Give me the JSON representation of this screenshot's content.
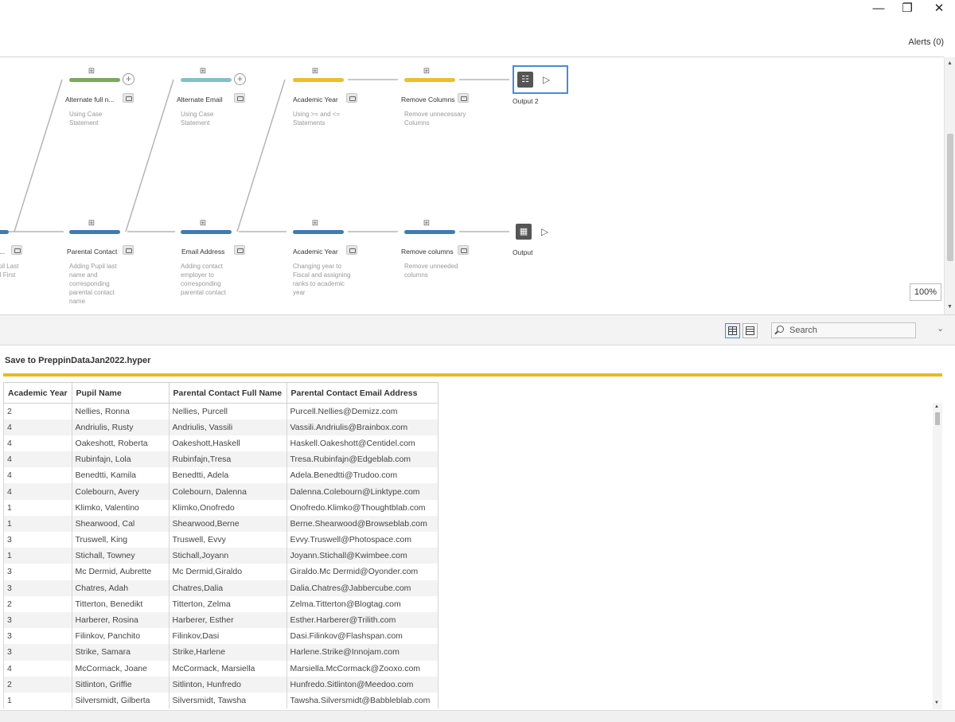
{
  "window": {
    "minimize_icon": "minimize-icon",
    "restore_icon": "restore-icon",
    "close_icon": "close-icon"
  },
  "alerts_label": "Alerts (0)",
  "flow": {
    "top_row": [
      {
        "name": "Alternate full n...",
        "desc": [
          "Using Case",
          "Statement"
        ],
        "color": "#7aa95c"
      },
      {
        "name": "Alternate Email",
        "desc": [
          "Using Case",
          "Statement"
        ],
        "color": "#83c1c9"
      },
      {
        "name": "Academic Year",
        "desc": [
          "Using >= and <=",
          "Statements"
        ],
        "color": "#ecbe2b"
      },
      {
        "name": "Remove Columns",
        "desc": [
          "Remove unnecessary",
          "Columns"
        ],
        "color": "#ecbe2b"
      }
    ],
    "top_output": {
      "name": "Output 2"
    },
    "bottom_row": [
      {
        "name": "...",
        "desc": [
          "pil Last",
          "il First"
        ],
        "color": "#3f7cae"
      },
      {
        "name": "Parental Contact",
        "desc": [
          "Adding Pupil last",
          "name and",
          "corresponding",
          "parental contact",
          "name"
        ],
        "color": "#3f7cae"
      },
      {
        "name": "Email Address",
        "desc": [
          "Adding contact",
          "employer to",
          "corresponding",
          "parental contact"
        ],
        "color": "#3f7cae"
      },
      {
        "name": "Academic Year",
        "desc": [
          "Changing year to",
          "Fiscal and assigning",
          "ranks to academic",
          "year"
        ],
        "color": "#3f7cae"
      },
      {
        "name": "Remove columns",
        "desc": [
          "Remove unneeded",
          "columns"
        ],
        "color": "#3f7cae"
      }
    ],
    "bottom_output": {
      "name": "Output"
    },
    "zoom": "100%"
  },
  "search": {
    "placeholder": "Search"
  },
  "save_label": "Save to PreppinDataJan2022.hyper",
  "table": {
    "columns": [
      "Academic Year",
      "Pupil Name",
      "Parental Contact Full Name",
      "Parental Contact Email Address"
    ],
    "rows": [
      [
        "2",
        "Nellies, Ronna",
        "Nellies, Purcell",
        "Purcell.Nellies@Demizz.com"
      ],
      [
        "4",
        "Andriulis, Rusty",
        "Andriulis, Vassili",
        "Vassili.Andriulis@Brainbox.com"
      ],
      [
        "4",
        "Oakeshott, Roberta",
        "Oakeshott,Haskell",
        "Haskell.Oakeshott@Centidel.com"
      ],
      [
        "4",
        "Rubinfajn, Lola",
        "Rubinfajn,Tresa",
        "Tresa.Rubinfajn@Edgeblab.com"
      ],
      [
        "4",
        "Benedtti, Kamila",
        "Benedtti, Adela",
        "Adela.Benedtti@Trudoo.com"
      ],
      [
        "4",
        "Colebourn, Avery",
        "Colebourn, Dalenna",
        "Dalenna.Colebourn@Linktype.com"
      ],
      [
        "1",
        "Klimko, Valentino",
        "Klimko,Onofredo",
        "Onofredo.Klimko@Thoughtblab.com"
      ],
      [
        "1",
        "Shearwood, Cal",
        "Shearwood,Berne",
        "Berne.Shearwood@Browseblab.com"
      ],
      [
        "3",
        "Truswell, King",
        "Truswell, Evvy",
        "Evvy.Truswell@Photospace.com"
      ],
      [
        "1",
        "Stichall, Towney",
        "Stichall,Joyann",
        "Joyann.Stichall@Kwimbee.com"
      ],
      [
        "3",
        "Mc Dermid, Aubrette",
        "Mc Dermid,Giraldo",
        "Giraldo.Mc Dermid@Oyonder.com"
      ],
      [
        "3",
        "Chatres, Adah",
        "Chatres,Dalia",
        "Dalia.Chatres@Jabbercube.com"
      ],
      [
        "2",
        "Titterton, Benedikt",
        "Titterton, Zelma",
        "Zelma.Titterton@Blogtag.com"
      ],
      [
        "3",
        "Harberer, Rosina",
        "Harberer, Esther",
        "Esther.Harberer@Trilith.com"
      ],
      [
        "3",
        "Filinkov, Panchito",
        "Filinkov,Dasi",
        "Dasi.Filinkov@Flashspan.com"
      ],
      [
        "3",
        "Strike, Samara",
        "Strike,Harlene",
        "Harlene.Strike@Innojam.com"
      ],
      [
        "4",
        "McCormack, Joane",
        "McCormack, Marsiella",
        "Marsiella.McCormack@Zooxo.com"
      ],
      [
        "2",
        "Sitlinton, Griffie",
        "Sitlinton, Hunfredo",
        "Hunfredo.Sitlinton@Meedoo.com"
      ],
      [
        "1",
        "Silversmidt, Gilberta",
        "Silversmidt, Tawsha",
        "Tawsha.Silversmidt@Babbleblab.com"
      ]
    ]
  }
}
